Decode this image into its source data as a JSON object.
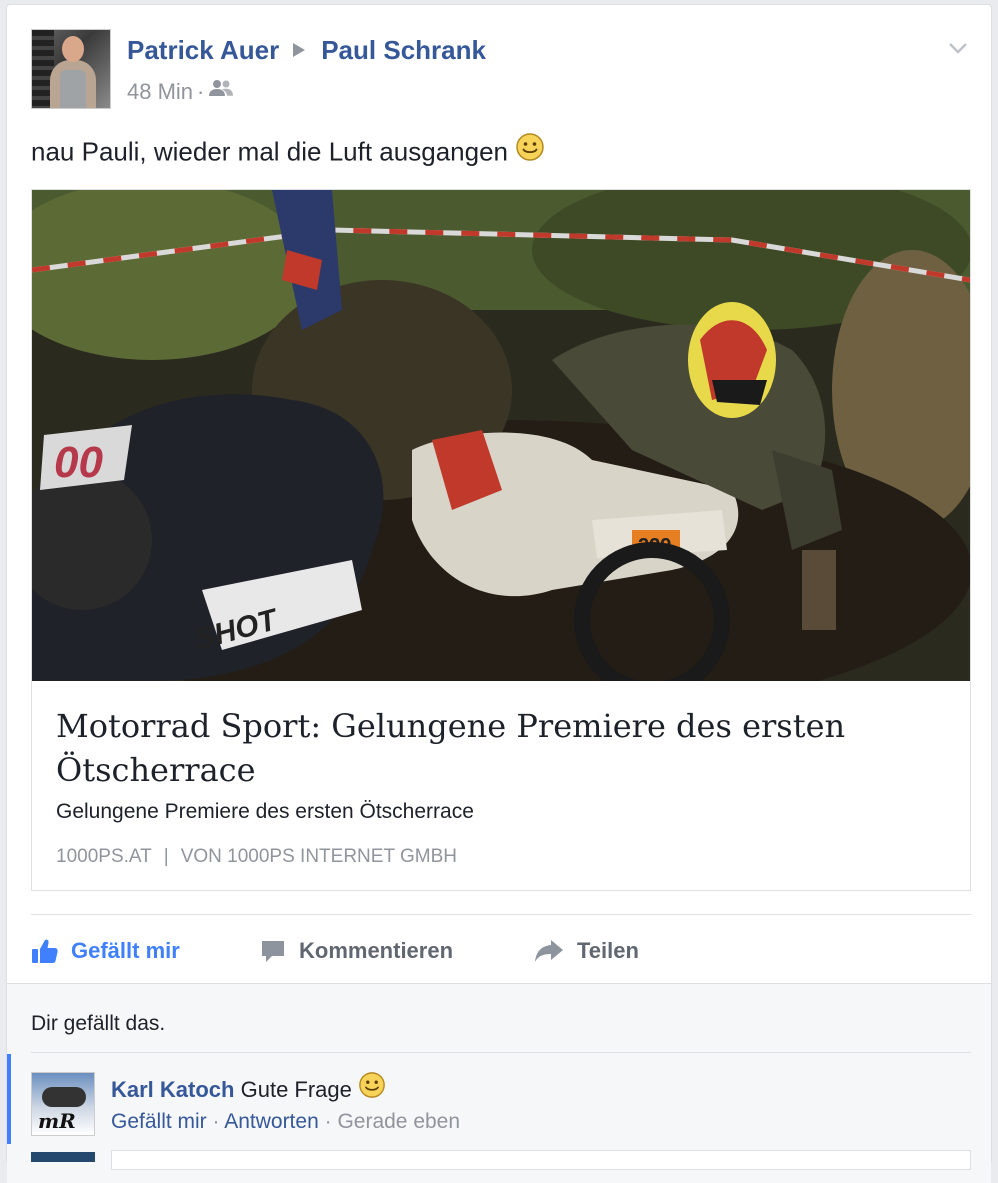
{
  "post": {
    "author": "Patrick Auer",
    "target": "Paul Schrank",
    "time": "48 Min",
    "audience_icon": "friends-icon",
    "status": "nau Pauli, wieder mal die Luft ausgangen"
  },
  "link": {
    "title": "Motorrad Sport: Gelungene Premiere des ersten Ötscherrace",
    "description": "Gelungene Premiere des ersten Ötscherrace",
    "domain": "1000PS.AT",
    "byline": "VON 1000PS INTERNET GMBH"
  },
  "actions": {
    "like": "Gefällt mir",
    "comment": "Kommentieren",
    "share": "Teilen"
  },
  "likes_summary": "Dir gefällt das.",
  "comment": {
    "author": "Karl Katoch",
    "text": "Gute Frage",
    "like": "Gefällt mir",
    "reply": "Antworten",
    "time": "Gerade eben"
  },
  "colors": {
    "link_blue": "#365899",
    "like_active": "#4080ff",
    "muted": "#90949c"
  }
}
